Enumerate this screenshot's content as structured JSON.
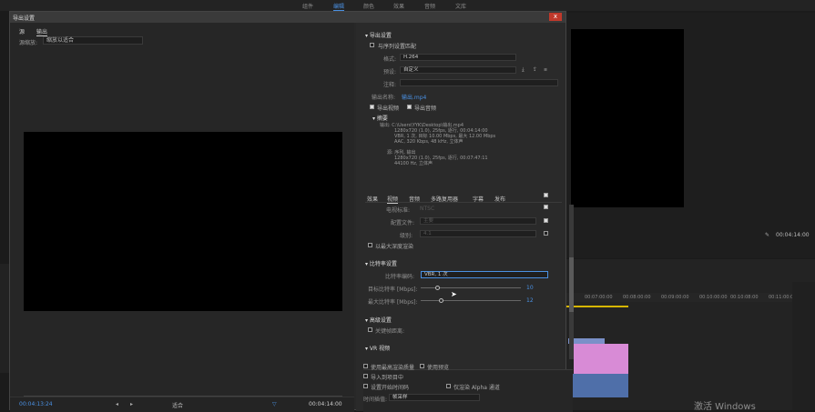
{
  "background": {
    "workspaces": [
      "组件",
      "编辑",
      "颜色",
      "效果",
      "音频",
      "文库"
    ],
    "active_workspace": "编辑",
    "program_timecode": "00:04:14:00",
    "ruler_ticks": [
      "00:07:00:00",
      "00:08:00:00",
      "00:09:00:00",
      "00:10:00:00",
      "00:10:08:00",
      "00:11:00:00"
    ],
    "watermark": "激活 Windows"
  },
  "dialog": {
    "title": "导出设置",
    "close": "x",
    "left_tabs": [
      "源",
      "输出"
    ],
    "active_left_tab": "输出",
    "source_scaling_label": "源缩放:",
    "source_scaling_value": "缩放以适合",
    "timecode_start": "00:04:13:24",
    "timecode_end": "00:04:14:00",
    "fit_label": "适合",
    "export_settings": {
      "section": "导出设置",
      "match_sequence_label": "与序列设置匹配",
      "format_label": "格式:",
      "format_value": "H.264",
      "preset_label": "预设:",
      "preset_value": "自定义",
      "comments_label": "注释:",
      "output_name_label": "输出名称:",
      "output_name_value": "输出.mp4",
      "export_video_label": "导出视频",
      "export_audio_label": "导出音频",
      "summary_label": "摘要",
      "summary_lines": [
        "输出: C:\\Users\\YYK\\Desktop\\输出.mp4",
        "1280x720 (1.0), 25fps, 逐行, 00:04:14:00",
        "VBR, 1 次, 目标 10.00 Mbps, 最大 12.00 Mbps",
        "AAC, 320 Kbps, 48 kHz, 立体声",
        "源: 序列, 输出",
        "1280x720 (1.0), 25fps, 逐行, 00:07:47:11",
        "44100 Hz, 立体声"
      ]
    },
    "right_tabs": [
      "效果",
      "视频",
      "音频",
      "多路复用器",
      "字幕",
      "发布"
    ],
    "active_right_tab": "视频",
    "video_rows": [
      {
        "label": "电视标准:",
        "value": "NTSC"
      },
      {
        "label": "配置文件:",
        "value": "主要"
      },
      {
        "label": "级别:",
        "value": "4.1"
      }
    ],
    "render_max_depth_label": "以最大深度渲染",
    "bitrate_section": "比特率设置",
    "bitrate_encoding_label": "比特率编码:",
    "bitrate_encoding_value": "VBR, 1 次",
    "target_bitrate_label": "目标比特率 [Mbps]:",
    "target_bitrate_value": "10",
    "max_bitrate_label": "最大比特率 [Mbps]:",
    "max_bitrate_value": "12",
    "target_bitrate_fraction": 0.17,
    "max_bitrate_fraction": 0.2,
    "advanced_section": "高级设置",
    "keyframe_label": "关键帧距离:",
    "vr_section": "VR 视频",
    "bottom_options": {
      "max_quality": "使用最高渲染质量",
      "use_preview": "使用预览",
      "import_project": "导入到项目中",
      "set_start_timecode": "设置开始时间码",
      "render_alpha": "仅渲染 Alpha 通道",
      "time_interpolation_label": "时间插值:",
      "time_interpolation_value": "帧采样"
    }
  }
}
